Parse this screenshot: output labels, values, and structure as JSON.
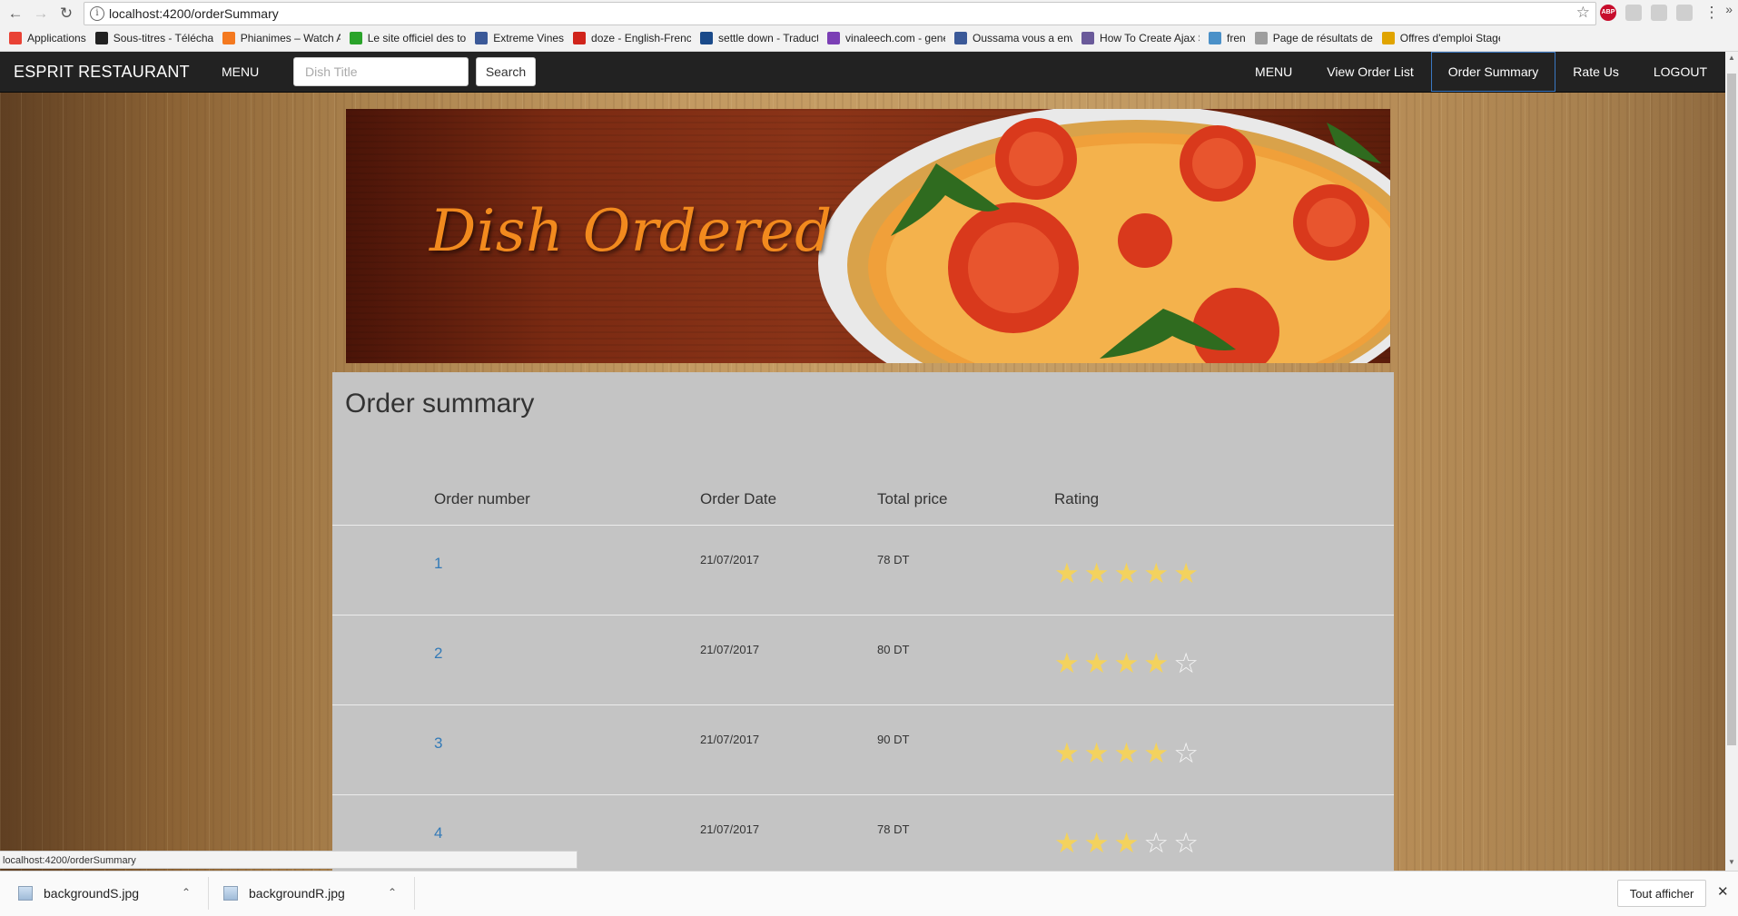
{
  "browser": {
    "url": "localhost:4200/orderSummary",
    "bookmarks": [
      {
        "label": "Applications",
        "color": "#e94235"
      },
      {
        "label": "Sous-titres - Télécha",
        "color": "#222222"
      },
      {
        "label": "Phianimes – Watch A",
        "color": "#f4791f"
      },
      {
        "label": "Le site officiel des to",
        "color": "#2aa32a"
      },
      {
        "label": "Extreme Vines",
        "color": "#3b5998"
      },
      {
        "label": "doze - English-French",
        "color": "#d0241b"
      },
      {
        "label": "settle down - Traduct",
        "color": "#1a4a8a"
      },
      {
        "label": "vinaleech.com - gene",
        "color": "#7b3fb5"
      },
      {
        "label": "Oussama vous a envo",
        "color": "#3b5998"
      },
      {
        "label": "How To Create Ajax S",
        "color": "#6a5a9a"
      },
      {
        "label": "fren",
        "color": "#4a90c8"
      },
      {
        "label": "Page de résultats de",
        "color": "#9e9e9e"
      },
      {
        "label": "Offres d'emploi Stage",
        "color": "#e0a400"
      }
    ]
  },
  "navbar": {
    "brand": "ESPRIT RESTAURANT",
    "menu": "MENU",
    "search_placeholder": "Dish Title",
    "search_button": "Search",
    "right_items": [
      "MENU",
      "View Order List",
      "Order Summary",
      "Rate Us",
      "LOGOUT"
    ],
    "active_item": "Order Summary"
  },
  "banner": {
    "title": "Dish Ordered"
  },
  "summary": {
    "title": "Order summary",
    "columns": [
      "Order number",
      "Order Date",
      "Total price",
      "Rating"
    ],
    "orders": [
      {
        "number": "1",
        "date": "21/07/2017",
        "price": "78 DT",
        "rating": 5
      },
      {
        "number": "2",
        "date": "21/07/2017",
        "price": "80 DT",
        "rating": 4
      },
      {
        "number": "3",
        "date": "21/07/2017",
        "price": "90 DT",
        "rating": 4
      },
      {
        "number": "4",
        "date": "21/07/2017",
        "price": "78 DT",
        "rating": 3
      }
    ],
    "max_rating": 5
  },
  "status_bar": {
    "text": "localhost:4200/orderSummary"
  },
  "downloads": {
    "files": [
      "backgroundS.jpg",
      "backgroundR.jpg"
    ],
    "show_all": "Tout afficher"
  },
  "colors": {
    "navbar": "#222222",
    "link": "#337ab7",
    "star_filled": "#f3d25e",
    "banner_text": "#f28a1e"
  }
}
